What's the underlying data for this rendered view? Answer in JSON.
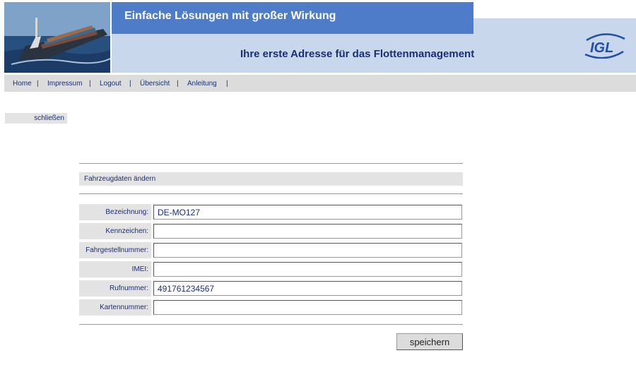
{
  "header": {
    "slogan": "Einfache Lösungen mit großer Wirkung",
    "tagline": "Ihre erste Adresse für das Flottenmanagement",
    "logo_text": "IGL"
  },
  "nav": {
    "items": [
      "Home",
      "Impressum",
      "Logout",
      "Übersicht",
      "Anleitung"
    ],
    "separator": "|"
  },
  "close_label": "schließen",
  "form": {
    "title": "Fahrzeugdaten ändern",
    "fields": [
      {
        "label": "Bezeichnung:",
        "value": "DE-MO127"
      },
      {
        "label": "Kennzeichen:",
        "value": ""
      },
      {
        "label": "Fahrgestellnummer:",
        "value": ""
      },
      {
        "label": "IMEI:",
        "value": ""
      },
      {
        "label": "Rufnummer:",
        "value": "491761234567"
      },
      {
        "label": "Kartennummer:",
        "value": ""
      }
    ],
    "save_label": "speichern"
  },
  "colors": {
    "slogan_bar": "#4f7cc8",
    "header_band": "#c8d7ec",
    "text_navy": "#1a2f73",
    "gray_bar": "#dcdcdc"
  }
}
